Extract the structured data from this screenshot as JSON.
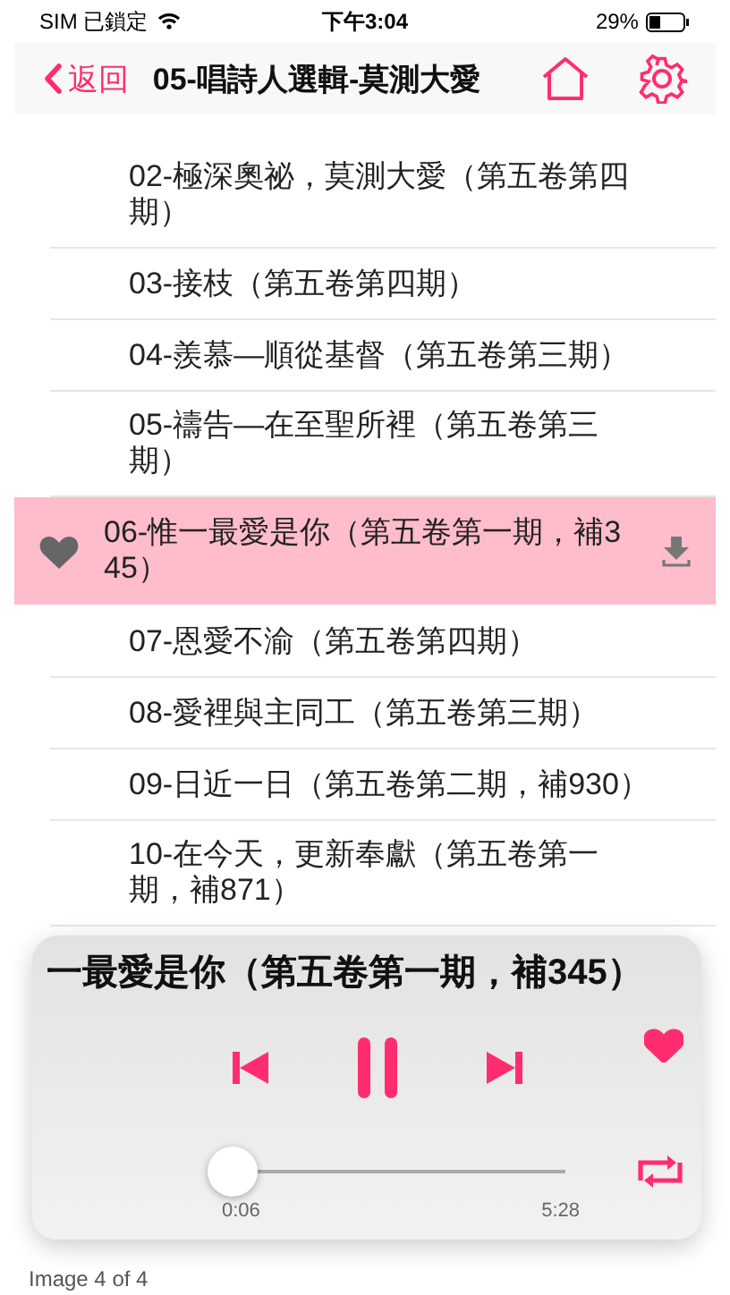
{
  "status_bar": {
    "carrier": "SIM 已鎖定",
    "time": "下午3:04",
    "battery": "29%"
  },
  "nav": {
    "back": "返回",
    "title": "05-唱詩人選輯-莫測大愛"
  },
  "songs": [
    {
      "title": "02-極深奧祕，莫測大愛（第五卷第四期）",
      "selected": false
    },
    {
      "title": "03-接枝（第五卷第四期）",
      "selected": false
    },
    {
      "title": "04-羨慕—順從基督（第五卷第三期）",
      "selected": false
    },
    {
      "title": "05-禱告—在至聖所裡（第五卷第三期）",
      "selected": false
    },
    {
      "title": "06-惟一最愛是你（第五卷第一期，補345）",
      "selected": true
    },
    {
      "title": "07-恩愛不渝（第五卷第四期）",
      "selected": false
    },
    {
      "title": "08-愛裡與主同工（第五卷第三期）",
      "selected": false
    },
    {
      "title": "09-日近一日（第五卷第二期，補930）",
      "selected": false
    },
    {
      "title": "10-在今天，更新奉獻（第五卷第一期，補871）",
      "selected": false
    }
  ],
  "player": {
    "title": "一最愛是你（第五卷第一期，補345）",
    "playing": true,
    "favorite": true,
    "level": 0.02,
    "elapsed": "0:06",
    "duration": "5:28"
  },
  "caption": "Image 4 of 4"
}
